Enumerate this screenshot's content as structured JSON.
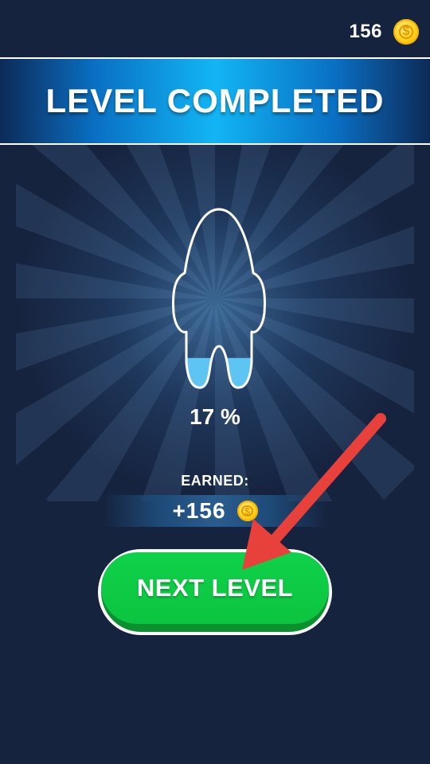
{
  "header": {
    "coin_count": "156",
    "coin_icon": "coin-icon",
    "coin_symbol": "$"
  },
  "banner": {
    "title": "LEVEL COMPLETED"
  },
  "result": {
    "character_icon": "character-silhouette-icon",
    "fill_percent_value": 17,
    "percent_text": "17 %"
  },
  "reward": {
    "label": "EARNED:",
    "value": "+156",
    "coin_icon": "coin-icon",
    "coin_symbol": "$"
  },
  "actions": {
    "next_label": "NEXT LEVEL",
    "hint_icon": "red-arrow-icon"
  },
  "colors": {
    "background": "#16233f",
    "banner_accent": "#12b5f5",
    "button_green": "#0fd14a",
    "fill_blue": "#5ec4f2",
    "arrow_red": "#e8413c",
    "coin_gold": "#ffcf1a"
  }
}
